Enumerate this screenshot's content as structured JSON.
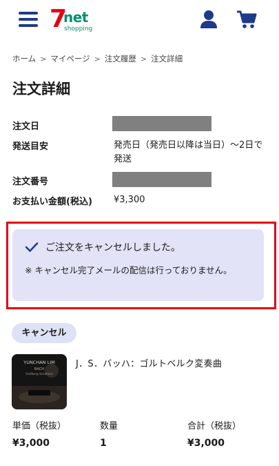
{
  "header": {
    "logo": {
      "seven": "7",
      "net": "net",
      "shopping": "shopping"
    },
    "menu_icon": "hamburger-menu-icon",
    "user_icon": "user-icon",
    "cart_icon": "cart-icon",
    "brand_color": "#1e3a8a"
  },
  "breadcrumb": {
    "items": [
      "ホーム",
      "マイページ",
      "注文履歴",
      "注文詳細"
    ]
  },
  "page": {
    "title": "注文詳細"
  },
  "order_info": {
    "order_date_label": "注文日",
    "ship_estimate_label": "発送目安",
    "ship_estimate_value": "発売日（発売日以降は当日）～2日で発送",
    "order_number_label": "注文番号",
    "total_label": "お支払い金額(税込)",
    "total_value": "¥3,300"
  },
  "alert": {
    "icon": "check-icon",
    "title": "ご注文をキャンセルしました。",
    "note": "※ キャンセル完了メールの配信は行っておりません。",
    "highlight_color": "#e60012",
    "background_color": "#e2e3f7"
  },
  "item": {
    "status_badge": "キャンセル",
    "name": "J．S．バッハ：ゴルトベルク変奏曲",
    "cover_text": {
      "artist": "YUNCHAN LIM",
      "composer": "BACH",
      "work": "Goldberg Variations"
    },
    "unit_price_label": "単価（税抜）",
    "unit_price_value": "¥3,000",
    "quantity_label": "数量",
    "quantity_value": "1",
    "subtotal_label": "合計（税抜）",
    "subtotal_value": "¥3,000"
  }
}
